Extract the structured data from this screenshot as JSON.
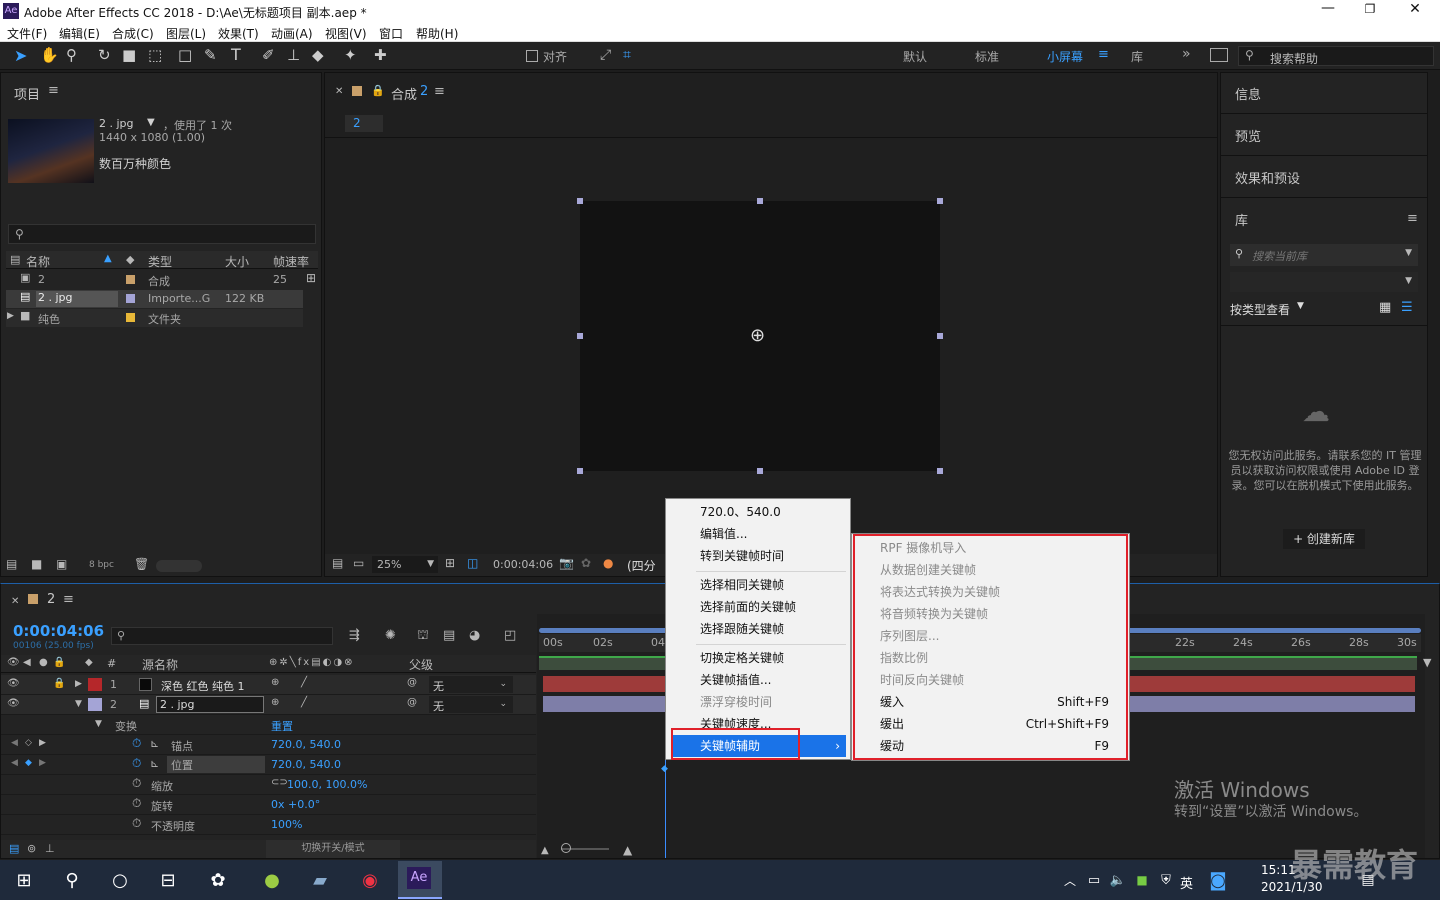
{
  "window": {
    "title": "Adobe After Effects CC 2018 - D:\\Ae\\无标题项目 副本.aep *",
    "ae_badge": "Ae"
  },
  "menus": [
    "文件(F)",
    "编辑(E)",
    "合成(C)",
    "图层(L)",
    "效果(T)",
    "动画(A)",
    "视图(V)",
    "窗口",
    "帮助(H)"
  ],
  "toolbar": {
    "align_label": "对齐",
    "workspaces": [
      "默认",
      "标准",
      "小屏幕",
      "库"
    ],
    "search_placeholder": "搜索帮助"
  },
  "project": {
    "title": "项目",
    "file_name": "2 . jpg",
    "used": "，使用了 1 次",
    "dims": "1440 x 1080 (1.00)",
    "color": "数百万种颜色",
    "headers": [
      "名称",
      "类型",
      "大小",
      "帧速率"
    ],
    "rows": [
      {
        "name": "2",
        "type": "合成",
        "size": "",
        "fps": "25"
      },
      {
        "name": "2 . jpg",
        "type": "Importe...G",
        "size": "122 KB",
        "fps": ""
      },
      {
        "name": "纯色",
        "type": "文件夹",
        "size": "",
        "fps": ""
      }
    ],
    "bpc": "8 bpc"
  },
  "composition": {
    "tab": "合成",
    "tab_num": "2",
    "subtab": "2",
    "zoom": "25%",
    "timecode": "0:00:04:06",
    "view_label": "(四分"
  },
  "right_panels": {
    "info": "信息",
    "preview": "预览",
    "effects": "效果和预设",
    "library": "库",
    "lib_search": "搜索当前库",
    "by_type": "按类型查看",
    "message": "您无权访问此服务。请联系您的 IT 管理员以获取访问权限或使用 Adobe ID 登录。您可以在脱机模式下使用此服务。",
    "create_lib": "+ 创建新库"
  },
  "timeline": {
    "tab_num": "2",
    "timecode": "0:00:04:06",
    "fps_info": "00106 (25.00 fps)",
    "col_source": "源名称",
    "col_parent": "父级",
    "layers": [
      {
        "num": "1",
        "name": "深色 红色 纯色 1",
        "parent": "无"
      },
      {
        "num": "2",
        "name": "2 . jpg",
        "parent": "无"
      }
    ],
    "transform": "变换",
    "reset": "重置",
    "props": [
      {
        "name": "锚点",
        "value": "720.0, 540.0"
      },
      {
        "name": "位置",
        "value": "720.0, 540.0"
      },
      {
        "name": "缩放",
        "value": "100.0, 100.0%"
      },
      {
        "name": "旋转",
        "value": "0x +0.0°"
      },
      {
        "name": "不透明度",
        "value": "100%"
      }
    ],
    "ruler": [
      "00s",
      "02s",
      "04",
      "22s",
      "24s",
      "26s",
      "28s",
      "30s"
    ],
    "switch_modes": "切换开关/模式"
  },
  "context_menu": {
    "items": [
      "720.0、540.0",
      "编辑值...",
      "转到关键帧时间",
      "选择相同关键帧",
      "选择前面的关键帧",
      "选择跟随关键帧",
      "切换定格关键帧",
      "关键帧插值...",
      "漂浮穿梭时间",
      "关键帧速度...",
      "关键帧辅助"
    ]
  },
  "submenu": {
    "items": [
      {
        "label": "RPF 摄像机导入",
        "shortcut": ""
      },
      {
        "label": "从数据创建关键帧",
        "shortcut": ""
      },
      {
        "label": "将表达式转换为关键帧",
        "shortcut": ""
      },
      {
        "label": "将音频转换为关键帧",
        "shortcut": ""
      },
      {
        "label": "序列图层...",
        "shortcut": ""
      },
      {
        "label": "指数比例",
        "shortcut": ""
      },
      {
        "label": "时间反向关键帧",
        "shortcut": ""
      },
      {
        "label": "缓入",
        "shortcut": "Shift+F9"
      },
      {
        "label": "缓出",
        "shortcut": "Ctrl+Shift+F9"
      },
      {
        "label": "缓动",
        "shortcut": "F9"
      }
    ]
  },
  "watermark": {
    "line1": "激活 Windows",
    "line2": "转到“设置”以激活 Windows。",
    "logo": "暴需教育"
  },
  "taskbar": {
    "time": "15:11",
    "date": "2021/1/30",
    "lang": "英",
    "ae": "Ae"
  }
}
